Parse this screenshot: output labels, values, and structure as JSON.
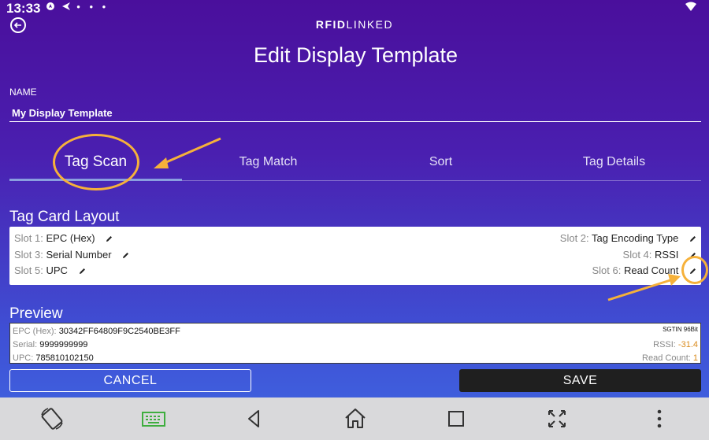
{
  "status": {
    "time": "13:33",
    "icons": [
      "location-icon",
      "arrow-icon",
      "dot-icon",
      "dot-icon",
      "dot-icon"
    ]
  },
  "header": {
    "brand_bold": "RFID",
    "brand_rest": "LINKED",
    "title": "Edit Display Template"
  },
  "name": {
    "label": "NAME",
    "value": "My Display Template"
  },
  "tabs": [
    {
      "label": "Tag Scan",
      "active": true
    },
    {
      "label": "Tag Match",
      "active": false
    },
    {
      "label": "Sort",
      "active": false
    },
    {
      "label": "Tag Details",
      "active": false
    }
  ],
  "layout": {
    "title": "Tag Card Layout",
    "slots": [
      {
        "label": "Slot 1:",
        "value": "EPC (Hex)"
      },
      {
        "label": "Slot 2:",
        "value": "Tag Encoding Type"
      },
      {
        "label": "Slot 3:",
        "value": "Serial Number"
      },
      {
        "label": "Slot 4:",
        "value": "RSSI"
      },
      {
        "label": "Slot 5:",
        "value": "UPC"
      },
      {
        "label": "Slot 6:",
        "value": "Read Count"
      }
    ]
  },
  "preview": {
    "title": "Preview",
    "epc_label": "EPC (Hex):",
    "epc_value": "30342FF64809F9C2540BE3FF",
    "encoding": "SGTIN 96Bit",
    "serial_label": "Serial:",
    "serial_value": "9999999999",
    "rssi_label": "RSSI:",
    "rssi_value": "-31.4",
    "upc_label": "UPC:",
    "upc_value": "785810102150",
    "count_label": "Read Count:",
    "count_value": "1"
  },
  "actions": {
    "cancel": "CANCEL",
    "save": "SAVE"
  },
  "colors": {
    "accent_annotation": "#f6b13a",
    "save_bg": "#1f1f1f",
    "rssi_value": "#d98a1c"
  },
  "navbar": [
    "rotate-icon",
    "keyboard-icon",
    "back-triangle-icon",
    "home-icon",
    "recents-square-icon",
    "fullscreen-icon",
    "more-vertical-icon"
  ]
}
